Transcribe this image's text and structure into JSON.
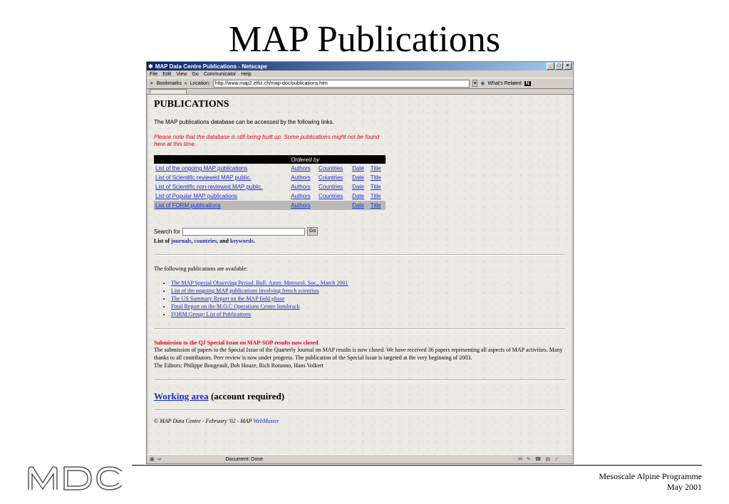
{
  "slide": {
    "title": "MAP Publications",
    "footer_line1": "Mesoscale Alpine Programme",
    "footer_line2": "May 2001"
  },
  "browser": {
    "window_title": "MAP Data Centre Publications - Netscape",
    "menu": [
      "File",
      "Edit",
      "View",
      "Go",
      "Communicator",
      "Help"
    ],
    "bookmarks_label": "Bookmarks",
    "location_label": "Location:",
    "url": "http://www.map2.ethz.ch/map-doc/publications.htm",
    "whats_related": "What's Related",
    "status": "Document: Done"
  },
  "page": {
    "heading": "PUBLICATIONS",
    "intro": "The MAP publications database can be accessed by the following links.",
    "note": "Please note that the database is still being built up. Some publications might not be found here at this time.",
    "table_header": "Ordered by",
    "rows": [
      {
        "name": "List of the ongoing MAP publications",
        "authors": "Authors",
        "countries": "Countries",
        "date": "Date",
        "title": "Title"
      },
      {
        "name": "List of Scientific reviewed MAP public.",
        "authors": "Authors",
        "countries": "Countries",
        "date": "Date",
        "title": "Title"
      },
      {
        "name": "List of Scientific non-reviewed MAP public.",
        "authors": "Authors",
        "countries": "Countries",
        "date": "Date",
        "title": "Title"
      },
      {
        "name": "List of Popular MAP publications",
        "authors": "Authors",
        "countries": "Countries",
        "date": "Date",
        "title": "Title"
      },
      {
        "name": "List of FORM publications",
        "authors": "Authors",
        "countries": "",
        "date": "Date",
        "title": "Title"
      }
    ],
    "search_label": "Search for",
    "search_value": "",
    "go_label": "Go",
    "lists_prefix": "List of",
    "journals": "journals",
    "countries": "countries",
    "and": "and",
    "keywords": "keywords",
    "available_intro": "The following publications are available:",
    "publications": [
      "The MAP Special Observing Period. Bull. Amer. Meteorol. Soc., March 2001",
      "List of the ongoing MAP publications involving french scientists",
      "The US Summary Report on the MAP field phase",
      "Final Report on the M.O.C Operations Centre Innsbruck",
      "FORM Group: List of Publications"
    ],
    "submission_title": "Submission to the QJ Special Issue on MAP-SOP results now closed",
    "submission_body": "The submission of papers to the Special Issue of the Quarterly Journal on MAP results is now closed. We have received 36 papers representing all aspects of MAP activities. Many thanks to all contributors. Peer review is now under progress. The publication of the Special Issue is targeted at the very beginning of 2003.",
    "editors": "The Editors: Philippe Bougeault, Bob Houze, Rich Rotunno, Hans Volkert",
    "working_area": "Working area",
    "working_area_note": "(account required)",
    "copyright": "© MAP Data Centre - February '02 - MAP",
    "webmaster": "WebMaster"
  }
}
